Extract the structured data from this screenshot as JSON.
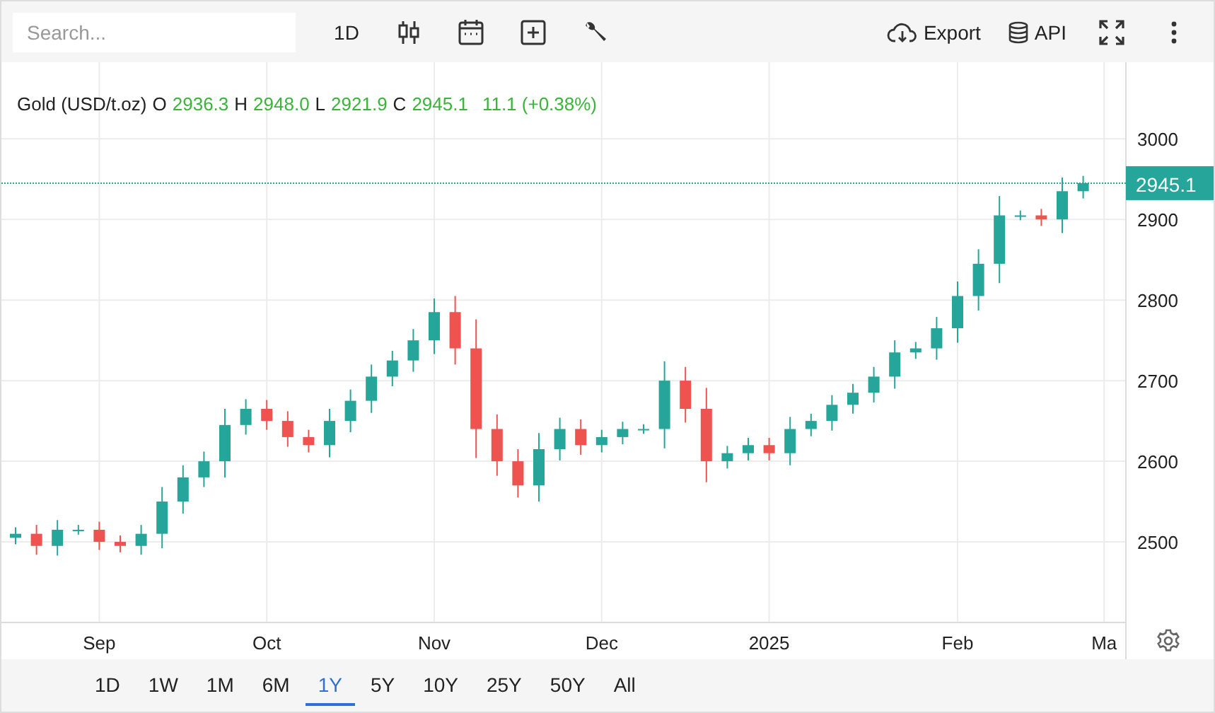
{
  "toolbar": {
    "search": {
      "placeholder": "Search..."
    },
    "interval": "1D",
    "export": "Export",
    "api": "API"
  },
  "legend": {
    "symbol": "Gold (USD/t.oz)",
    "items": [
      {
        "label": "O",
        "value": "2936.3"
      },
      {
        "label": "H",
        "value": "2948.0"
      },
      {
        "label": "L",
        "value": "2921.9"
      },
      {
        "label": "C",
        "value": "2945.1"
      }
    ],
    "change": "11.1 (+0.38%)"
  },
  "chart": {
    "chart_data": {
      "type": "candlestick",
      "ylim": [
        2400,
        3095
      ],
      "yticks": [
        2500,
        2600,
        2700,
        2800,
        2900,
        3000
      ],
      "grid": true,
      "categories": [
        null,
        null,
        null,
        null,
        "Sep",
        null,
        null,
        null,
        null,
        null,
        null,
        null,
        "Oct",
        null,
        null,
        null,
        null,
        null,
        null,
        null,
        "Nov",
        null,
        null,
        null,
        null,
        null,
        null,
        null,
        "Dec",
        null,
        null,
        null,
        null,
        null,
        null,
        null,
        "2025",
        null,
        null,
        null,
        null,
        null,
        null,
        null,
        null,
        "Feb",
        null,
        null,
        null,
        null,
        null,
        null,
        "Ma"
      ],
      "ohlc": [
        [
          2505,
          2518,
          2497,
          2510
        ],
        [
          2510,
          2521,
          2484,
          2495
        ],
        [
          2495,
          2527,
          2483,
          2515
        ],
        [
          2515,
          2521,
          2509,
          2515
        ],
        [
          2515,
          2525,
          2490,
          2500
        ],
        [
          2500,
          2508,
          2487,
          2495
        ],
        [
          2495,
          2521,
          2484,
          2510
        ],
        [
          2510,
          2568,
          2492,
          2550
        ],
        [
          2550,
          2595,
          2535,
          2580
        ],
        [
          2580,
          2612,
          2568,
          2600
        ],
        [
          2600,
          2665,
          2580,
          2645
        ],
        [
          2645,
          2677,
          2633,
          2665
        ],
        [
          2665,
          2676,
          2639,
          2650
        ],
        [
          2650,
          2662,
          2618,
          2630
        ],
        [
          2630,
          2639,
          2611,
          2620
        ],
        [
          2620,
          2665,
          2605,
          2650
        ],
        [
          2650,
          2689,
          2636,
          2675
        ],
        [
          2675,
          2720,
          2660,
          2705
        ],
        [
          2705,
          2737,
          2693,
          2725
        ],
        [
          2725,
          2764,
          2711,
          2750
        ],
        [
          2750,
          2802,
          2733,
          2785
        ],
        [
          2785,
          2805,
          2720,
          2740
        ],
        [
          2740,
          2776,
          2604,
          2640
        ],
        [
          2640,
          2658,
          2582,
          2600
        ],
        [
          2600,
          2615,
          2555,
          2570
        ],
        [
          2570,
          2635,
          2550,
          2615
        ],
        [
          2615,
          2654,
          2601,
          2640
        ],
        [
          2640,
          2652,
          2608,
          2620
        ],
        [
          2620,
          2639,
          2611,
          2630
        ],
        [
          2630,
          2649,
          2621,
          2640
        ],
        [
          2640,
          2646,
          2634,
          2640
        ],
        [
          2640,
          2724,
          2616,
          2700
        ],
        [
          2700,
          2717,
          2648,
          2665
        ],
        [
          2665,
          2691,
          2574,
          2600
        ],
        [
          2600,
          2619,
          2591,
          2610
        ],
        [
          2610,
          2629,
          2601,
          2620
        ],
        [
          2620,
          2629,
          2601,
          2610
        ],
        [
          2610,
          2655,
          2595,
          2640
        ],
        [
          2640,
          2659,
          2631,
          2650
        ],
        [
          2650,
          2682,
          2638,
          2670
        ],
        [
          2670,
          2696,
          2659,
          2685
        ],
        [
          2685,
          2717,
          2673,
          2705
        ],
        [
          2705,
          2750,
          2690,
          2735
        ],
        [
          2735,
          2748,
          2727,
          2740
        ],
        [
          2740,
          2779,
          2726,
          2765
        ],
        [
          2765,
          2823,
          2747,
          2805
        ],
        [
          2805,
          2863,
          2787,
          2845
        ],
        [
          2845,
          2929,
          2821,
          2905
        ],
        [
          2905,
          2911,
          2899,
          2905
        ],
        [
          2905,
          2913,
          2892,
          2900
        ],
        [
          2900,
          2952,
          2883,
          2935
        ],
        [
          2935,
          2954,
          2926,
          2945
        ],
        null
      ]
    },
    "last_price_label": "2945.1"
  },
  "ranges": [
    {
      "label": "1D",
      "selected": false
    },
    {
      "label": "1W",
      "selected": false
    },
    {
      "label": "1M",
      "selected": false
    },
    {
      "label": "6M",
      "selected": false
    },
    {
      "label": "1Y",
      "selected": true
    },
    {
      "label": "5Y",
      "selected": false
    },
    {
      "label": "10Y",
      "selected": false
    },
    {
      "label": "25Y",
      "selected": false
    },
    {
      "label": "50Y",
      "selected": false
    },
    {
      "label": "All",
      "selected": false
    }
  ]
}
